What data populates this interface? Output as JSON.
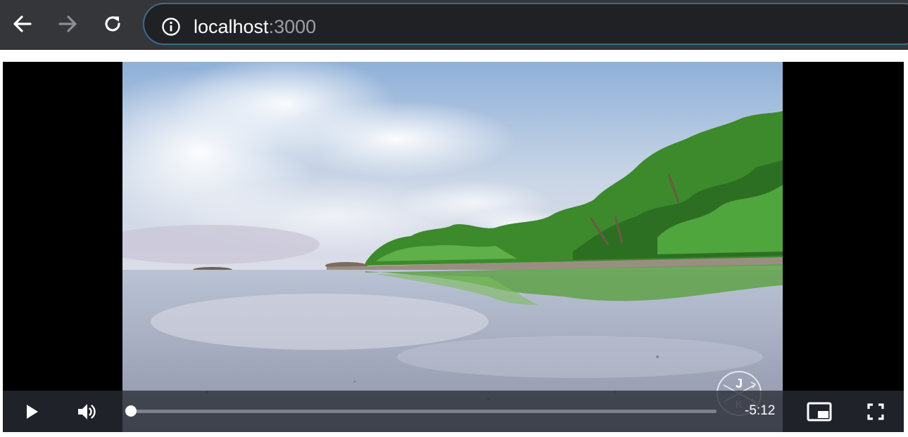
{
  "browser": {
    "host": "localhost",
    "port": ":3000",
    "back_icon": "arrow-left-icon",
    "forward_icon": "arrow-right-icon",
    "reload_icon": "reload-icon",
    "site_info_icon": "info-circle-icon"
  },
  "video": {
    "remaining_time": "-5:12",
    "progress": 0.0,
    "watermark_letters": [
      "J",
      "K"
    ],
    "controls": {
      "play_icon": "play-icon",
      "volume_icon": "volume-icon",
      "pip_icon": "picture-in-picture-icon",
      "fullscreen_icon": "fullscreen-icon"
    }
  },
  "colors": {
    "toolbar_bg": "#35363a",
    "omnibox_bg": "#202124",
    "omnibox_focus": "#3f6a8a",
    "url_muted": "#9aa0a6",
    "player_bg": "#000000"
  }
}
